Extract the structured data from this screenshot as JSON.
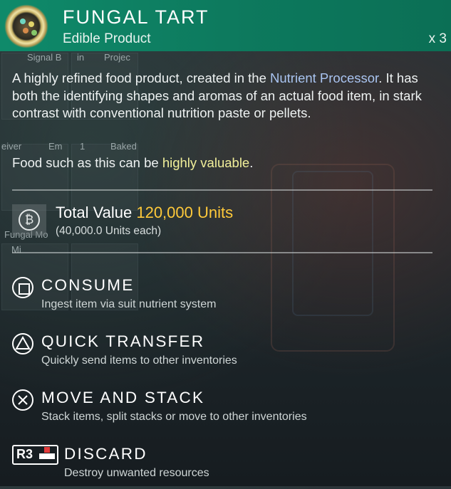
{
  "item": {
    "title": "FUNGAL TART",
    "subtitle": "Edible Product",
    "quantity": "x 3"
  },
  "description": {
    "part1": "A highly refined food product, created in the ",
    "link": "Nutrient Processor",
    "part2": ". It has both the identifying shapes and aromas of an actual food item, in stark contrast with conventional nutrition paste or pellets.",
    "line2_part1": "Food such as this can be ",
    "line2_highlight": "highly valuable",
    "line2_part2": "."
  },
  "value": {
    "label": "Total Value",
    "amount": "120,000 Units",
    "each": "(40,000.0 Units each)"
  },
  "actions": [
    {
      "label": "CONSUME",
      "description": "Ingest item via suit nutrient system",
      "button": "square"
    },
    {
      "label": "QUICK TRANSFER",
      "description": "Quickly send items to other inventories",
      "button": "triangle"
    },
    {
      "label": "MOVE AND STACK",
      "description": "Stack items, split stacks or move to other inventories",
      "button": "cross"
    },
    {
      "label": "DISCARD",
      "description": "Destroy unwanted resources",
      "button": "R3"
    }
  ],
  "background_labels": [
    "Signal B",
    "in",
    "Projec",
    "eiver",
    "Em",
    "1",
    "Baked",
    "Fungal Mo",
    "Mi"
  ],
  "colors": {
    "header": "#0d7a5e",
    "highlight_blue": "#a9c4f0",
    "highlight_yellow": "#f1ef9a",
    "value": "#ffc93a"
  }
}
